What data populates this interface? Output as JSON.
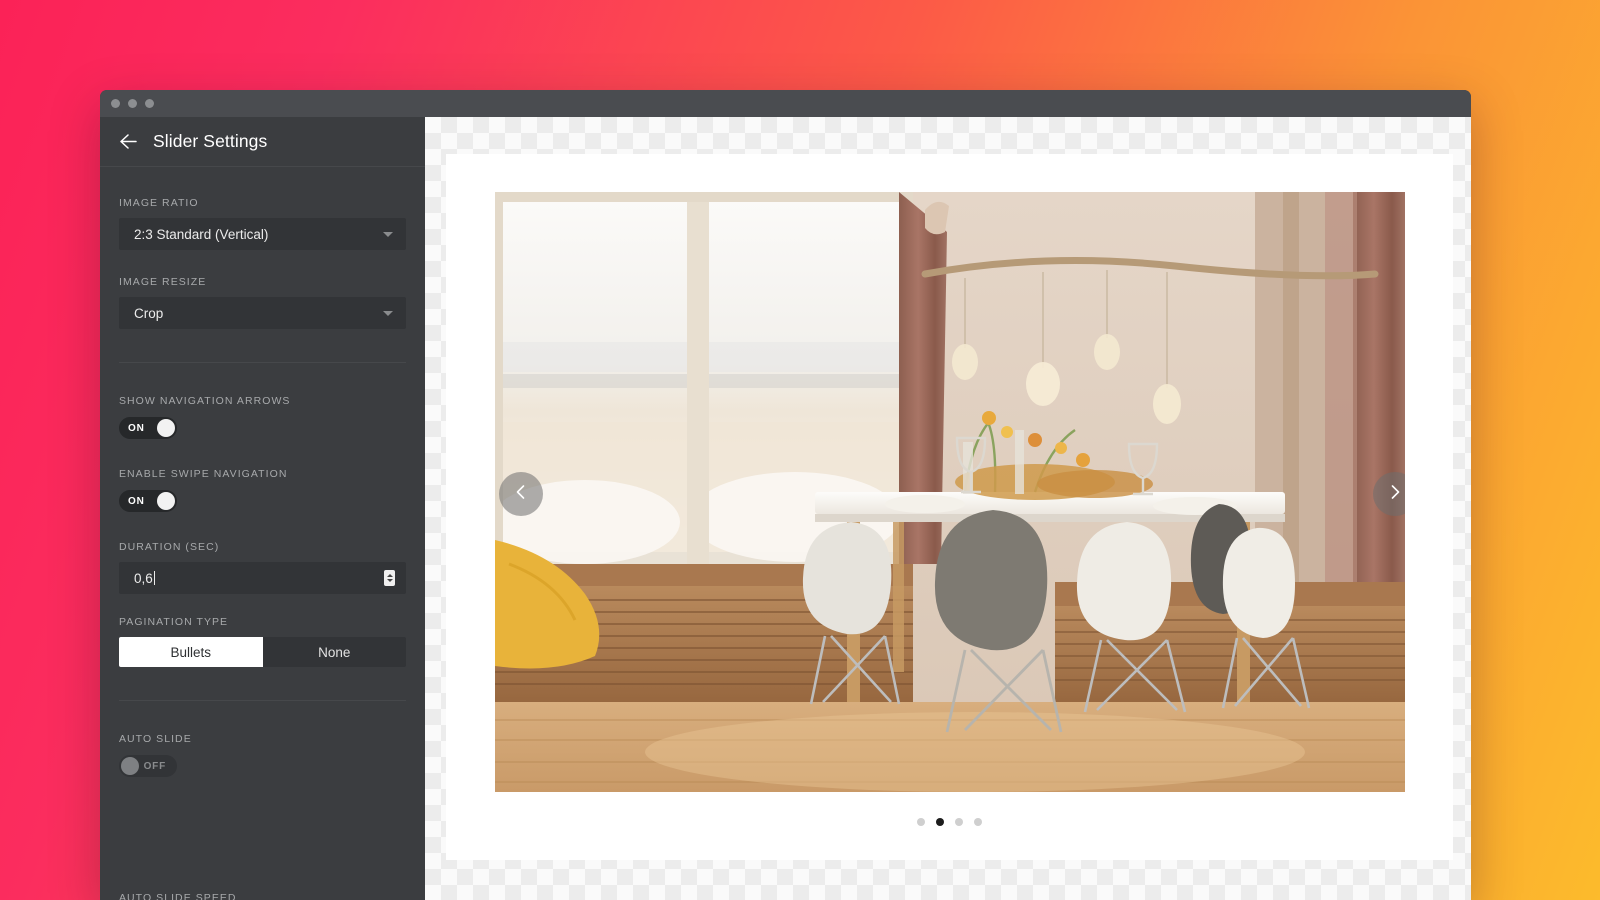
{
  "window": {
    "titlebar_dots": [
      "dot-1",
      "dot-2",
      "dot-3"
    ]
  },
  "sidebar": {
    "back_icon": "arrow-left-icon",
    "title": "Slider Settings",
    "fields": {
      "image_ratio": {
        "label": "IMAGE RATIO",
        "value": "2:3 Standard (Vertical)",
        "caret_icon": "chevron-down-icon"
      },
      "image_resize": {
        "label": "IMAGE RESIZE",
        "value": "Crop",
        "caret_icon": "chevron-down-icon"
      },
      "show_navigation_arrows": {
        "label": "SHOW NAVIGATION ARROWS",
        "state": "ON"
      },
      "enable_swipe_navigation": {
        "label": "ENABLE SWIPE NAVIGATION",
        "state": "ON"
      },
      "duration": {
        "label": "DURATION (SEC)",
        "value": "0,6",
        "spinner_icon": "number-spinner-icon"
      },
      "pagination_type": {
        "label": "PAGINATION TYPE",
        "options": [
          "Bullets",
          "None"
        ],
        "selected": "Bullets"
      },
      "auto_slide": {
        "label": "AUTO SLIDE",
        "state": "OFF"
      },
      "clipped_next": {
        "label": "AUTO SLIDE SPEED"
      }
    }
  },
  "preview": {
    "prev_icon": "chevron-left-icon",
    "next_icon": "chevron-right-icon",
    "pagination": {
      "count": 4,
      "active_index": 1
    },
    "image_alt": "dining-room-photo"
  },
  "colors": {
    "bg_gradient_start": "#FB2257",
    "bg_gradient_end": "#FCBB2C",
    "sidebar_bg": "#3b3d40",
    "field_bg": "#323437",
    "accent_white": "#ffffff"
  }
}
